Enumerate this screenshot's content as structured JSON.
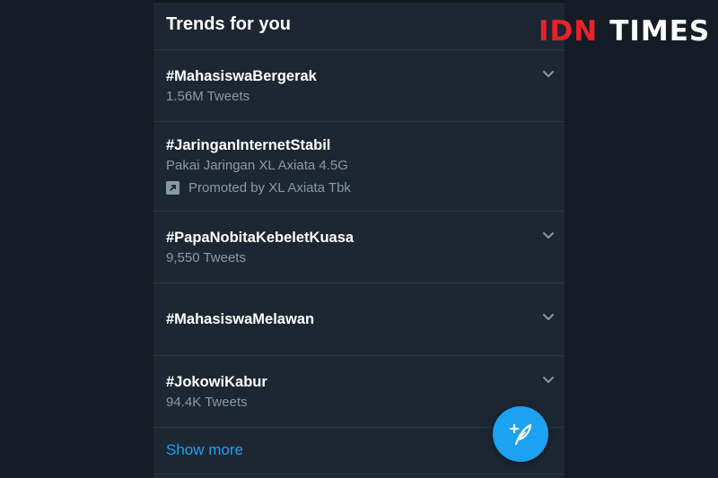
{
  "header": {
    "title": "Trends for you"
  },
  "trends": [
    {
      "tag": "#MahasiswaBergerak",
      "meta": "1.56M Tweets"
    },
    {
      "tag": "#JaringanInternetStabil",
      "meta": "Pakai Jaringan XL Axiata 4.5G",
      "promoted": "Promoted by XL Axiata Tbk"
    },
    {
      "tag": "#PapaNobitaKebeletKuasa",
      "meta": "9,550 Tweets"
    },
    {
      "tag": "#MahasiswaMelawan",
      "meta": ""
    },
    {
      "tag": "#JokowiKabur",
      "meta": "94.4K Tweets"
    }
  ],
  "footer": {
    "show_more": "Show more"
  },
  "fab": {
    "icon": "compose-tweet-icon"
  },
  "watermark": {
    "part1": "IDN",
    "part2": "TIMES"
  },
  "colors": {
    "accent": "#1da1f2",
    "background": "#1c2733",
    "secondary_text": "#8899a6",
    "logo_red": "#e8212b"
  }
}
